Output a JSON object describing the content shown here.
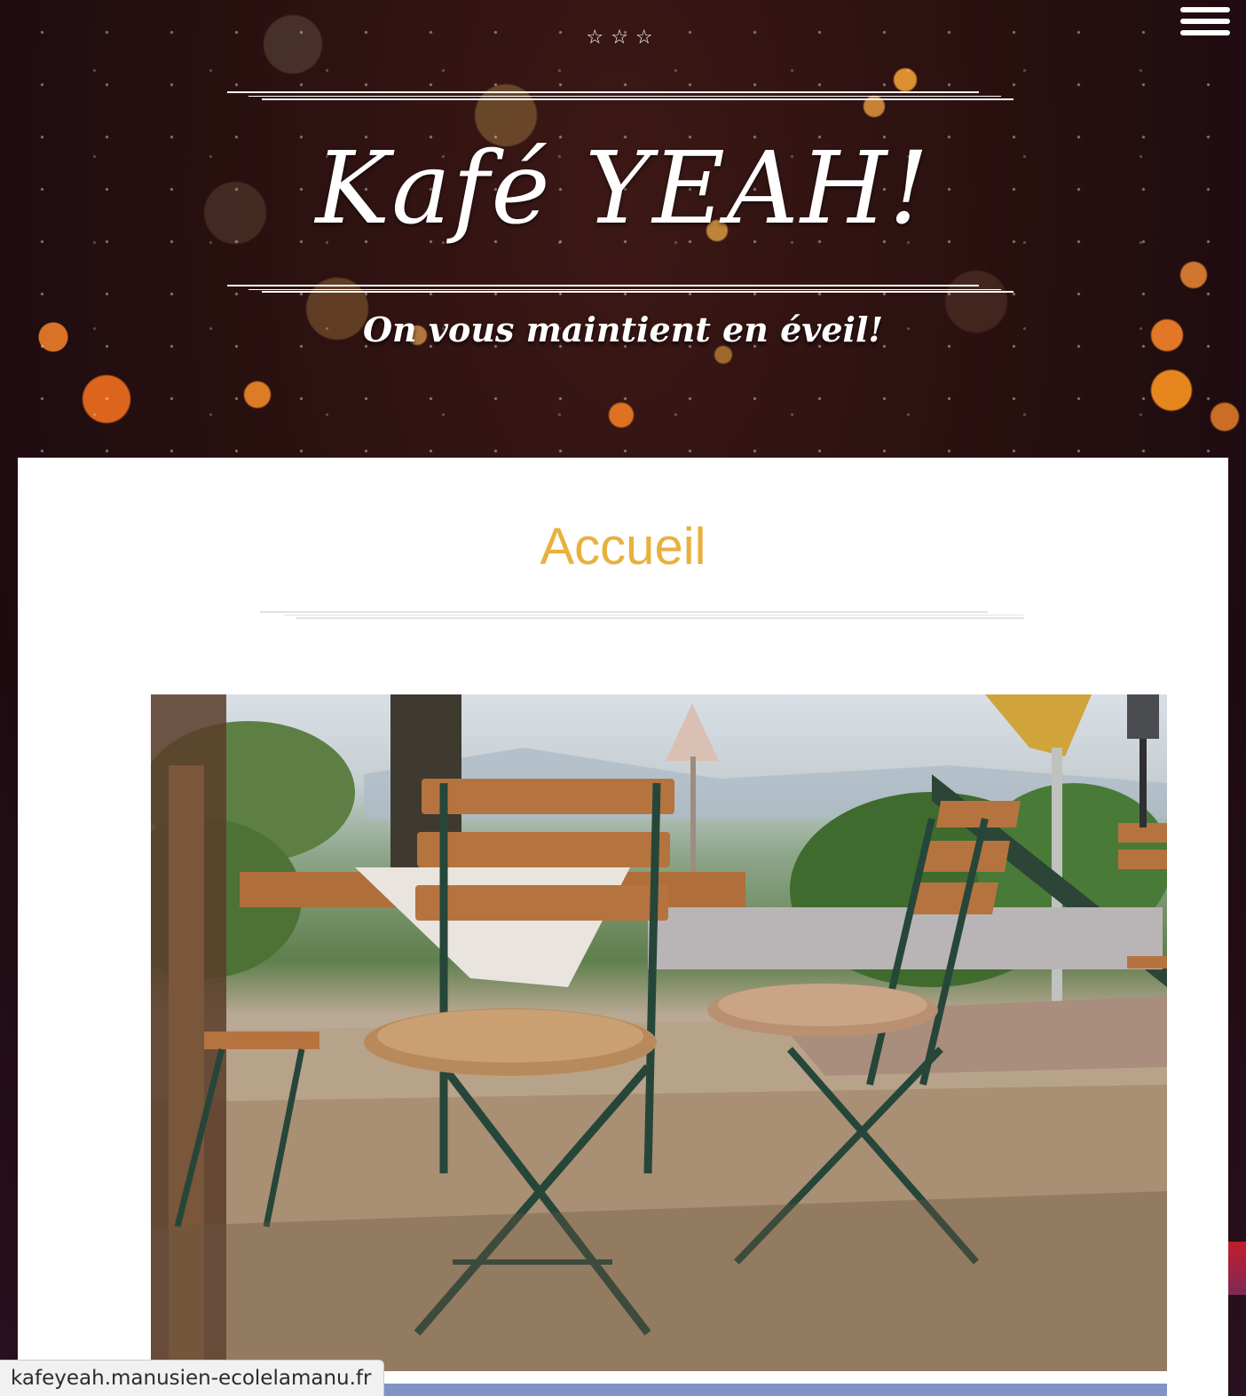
{
  "header": {
    "stars": "☆☆☆",
    "site_title": "Kafé YEAH!",
    "tagline": "On vous maintient en éveil!",
    "menu_icon": "hamburger-menu-icon"
  },
  "main": {
    "page_title": "Accueil",
    "hero_image": "outdoor-cafe-terrace-chairs-photo"
  },
  "status_bar": {
    "url": "kafeyeah.manusien-ecolelamanu.fr"
  },
  "colors": {
    "accent": "#e8b13e",
    "hero_bg": "#28100f",
    "card_bg": "#ffffff"
  }
}
